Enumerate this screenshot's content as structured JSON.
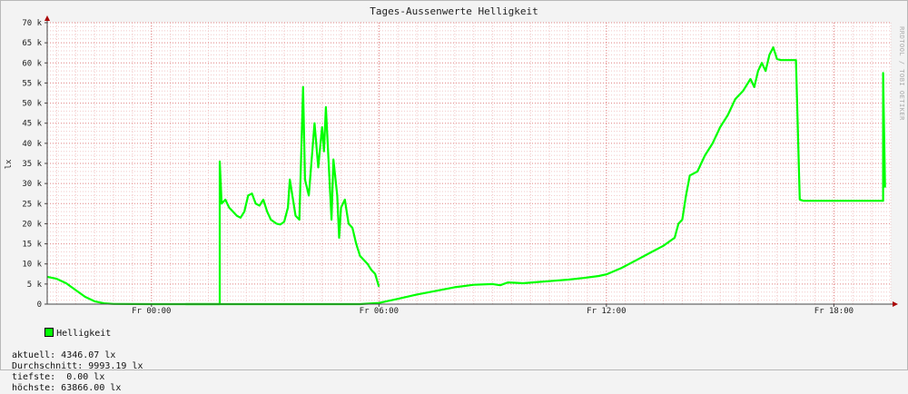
{
  "chart_data": {
    "type": "line",
    "title": "Tages-Aussenwerte Helligkeit",
    "ylabel": "lx",
    "xlabel": "",
    "side_label": "RRDTOOL / TOBI OETIKER",
    "ylim": [
      0,
      70000
    ],
    "xlim_hours": [
      -2.75,
      19.5
    ],
    "y_ticks": [
      {
        "v": 0,
        "label": "0"
      },
      {
        "v": 5000,
        "label": "5 k"
      },
      {
        "v": 10000,
        "label": "10 k"
      },
      {
        "v": 15000,
        "label": "15 k"
      },
      {
        "v": 20000,
        "label": "20 k"
      },
      {
        "v": 25000,
        "label": "25 k"
      },
      {
        "v": 30000,
        "label": "30 k"
      },
      {
        "v": 35000,
        "label": "35 k"
      },
      {
        "v": 40000,
        "label": "40 k"
      },
      {
        "v": 45000,
        "label": "45 k"
      },
      {
        "v": 50000,
        "label": "50 k"
      },
      {
        "v": 55000,
        "label": "55 k"
      },
      {
        "v": 60000,
        "label": "60 k"
      },
      {
        "v": 65000,
        "label": "65 k"
      },
      {
        "v": 70000,
        "label": "70 k"
      }
    ],
    "x_ticks": [
      {
        "h": 0,
        "label": "Fr 00:00"
      },
      {
        "h": 6,
        "label": "Fr 06:00"
      },
      {
        "h": 12,
        "label": "Fr 12:00"
      },
      {
        "h": 18,
        "label": "Fr 18:00"
      }
    ],
    "grid": true,
    "series": [
      {
        "name": "Helligkeit",
        "color": "#00ff00",
        "points": [
          [
            -2.75,
            6800
          ],
          [
            -2.5,
            6300
          ],
          [
            -2.25,
            5200
          ],
          [
            -2.0,
            3500
          ],
          [
            -1.75,
            1800
          ],
          [
            -1.5,
            700
          ],
          [
            -1.25,
            200
          ],
          [
            -1.0,
            50
          ],
          [
            0.0,
            0
          ],
          [
            4.0,
            0
          ],
          [
            5.5,
            0
          ],
          [
            6.0,
            300
          ],
          [
            6.5,
            1300
          ],
          [
            7.0,
            2400
          ],
          [
            7.5,
            3300
          ],
          [
            8.0,
            4200
          ],
          [
            8.5,
            4800
          ],
          [
            9.0,
            5000
          ],
          [
            9.2,
            4700
          ],
          [
            9.4,
            5400
          ],
          [
            9.6,
            5300
          ],
          [
            9.8,
            5200
          ],
          [
            10.2,
            5500
          ],
          [
            10.6,
            5800
          ],
          [
            11.0,
            6100
          ],
          [
            11.4,
            6500
          ],
          [
            11.8,
            7000
          ],
          [
            12.0,
            7400
          ],
          [
            12.4,
            9000
          ],
          [
            12.8,
            11000
          ],
          [
            13.2,
            13000
          ],
          [
            13.5,
            14500
          ],
          [
            13.8,
            16500
          ],
          [
            13.9,
            20000
          ],
          [
            14.0,
            21000
          ],
          [
            14.1,
            27000
          ],
          [
            14.2,
            32000
          ],
          [
            14.4,
            33000
          ],
          [
            14.6,
            37000
          ],
          [
            14.8,
            40000
          ],
          [
            15.0,
            44000
          ],
          [
            15.2,
            47000
          ],
          [
            15.4,
            51000
          ],
          [
            15.6,
            53000
          ],
          [
            15.8,
            56000
          ],
          [
            15.9,
            54000
          ],
          [
            16.0,
            58000
          ],
          [
            16.1,
            60000
          ],
          [
            16.2,
            58000
          ],
          [
            16.3,
            62000
          ],
          [
            16.4,
            63866
          ],
          [
            16.5,
            61000
          ],
          [
            16.6,
            60700
          ],
          [
            16.9,
            60700
          ],
          [
            17.0,
            60700
          ],
          [
            17.1,
            26000
          ],
          [
            17.2,
            25700
          ],
          [
            19.2,
            25700
          ],
          [
            19.3,
            25700
          ],
          [
            19.3,
            57500
          ],
          [
            19.35,
            29000
          ]
        ]
      },
      {
        "name": "Helligkeit",
        "color": "#00ff00",
        "points": [
          [
            0.9,
            0
          ],
          [
            1.8,
            0
          ],
          [
            1.8,
            35500
          ],
          [
            1.85,
            25000
          ],
          [
            1.95,
            26000
          ],
          [
            2.05,
            24000
          ],
          [
            2.15,
            23000
          ],
          [
            2.25,
            22000
          ],
          [
            2.35,
            21500
          ],
          [
            2.45,
            23000
          ],
          [
            2.55,
            27000
          ],
          [
            2.65,
            27500
          ],
          [
            2.75,
            25000
          ],
          [
            2.85,
            24500
          ],
          [
            2.95,
            26000
          ],
          [
            3.05,
            23000
          ],
          [
            3.15,
            21000
          ],
          [
            3.3,
            20000
          ],
          [
            3.4,
            19800
          ],
          [
            3.5,
            20500
          ],
          [
            3.6,
            24000
          ],
          [
            3.65,
            31000
          ],
          [
            3.7,
            28000
          ],
          [
            3.8,
            22000
          ],
          [
            3.9,
            21000
          ],
          [
            4.0,
            54000
          ],
          [
            4.05,
            31000
          ],
          [
            4.15,
            27000
          ],
          [
            4.3,
            45000
          ],
          [
            4.4,
            34000
          ],
          [
            4.5,
            44000
          ],
          [
            4.55,
            38000
          ],
          [
            4.6,
            49000
          ],
          [
            4.7,
            30000
          ],
          [
            4.75,
            21000
          ],
          [
            4.8,
            36000
          ],
          [
            4.9,
            27000
          ],
          [
            4.95,
            16500
          ],
          [
            5.0,
            24000
          ],
          [
            5.1,
            26000
          ],
          [
            5.2,
            20000
          ],
          [
            5.3,
            19000
          ],
          [
            5.4,
            15000
          ],
          [
            5.5,
            12000
          ],
          [
            5.6,
            11000
          ],
          [
            5.7,
            10000
          ],
          [
            5.8,
            8500
          ],
          [
            5.9,
            7500
          ],
          [
            6.0,
            4346
          ]
        ]
      }
    ]
  },
  "legend": {
    "series_label": "Helligkeit",
    "aktuell": "aktuell: 4346.07 lx",
    "durchschnitt": "Durchschnitt: 9993.19 lx",
    "tiefste": "tiefste:  0.00 lx",
    "hoechste": "höchste: 63866.00 lx"
  }
}
